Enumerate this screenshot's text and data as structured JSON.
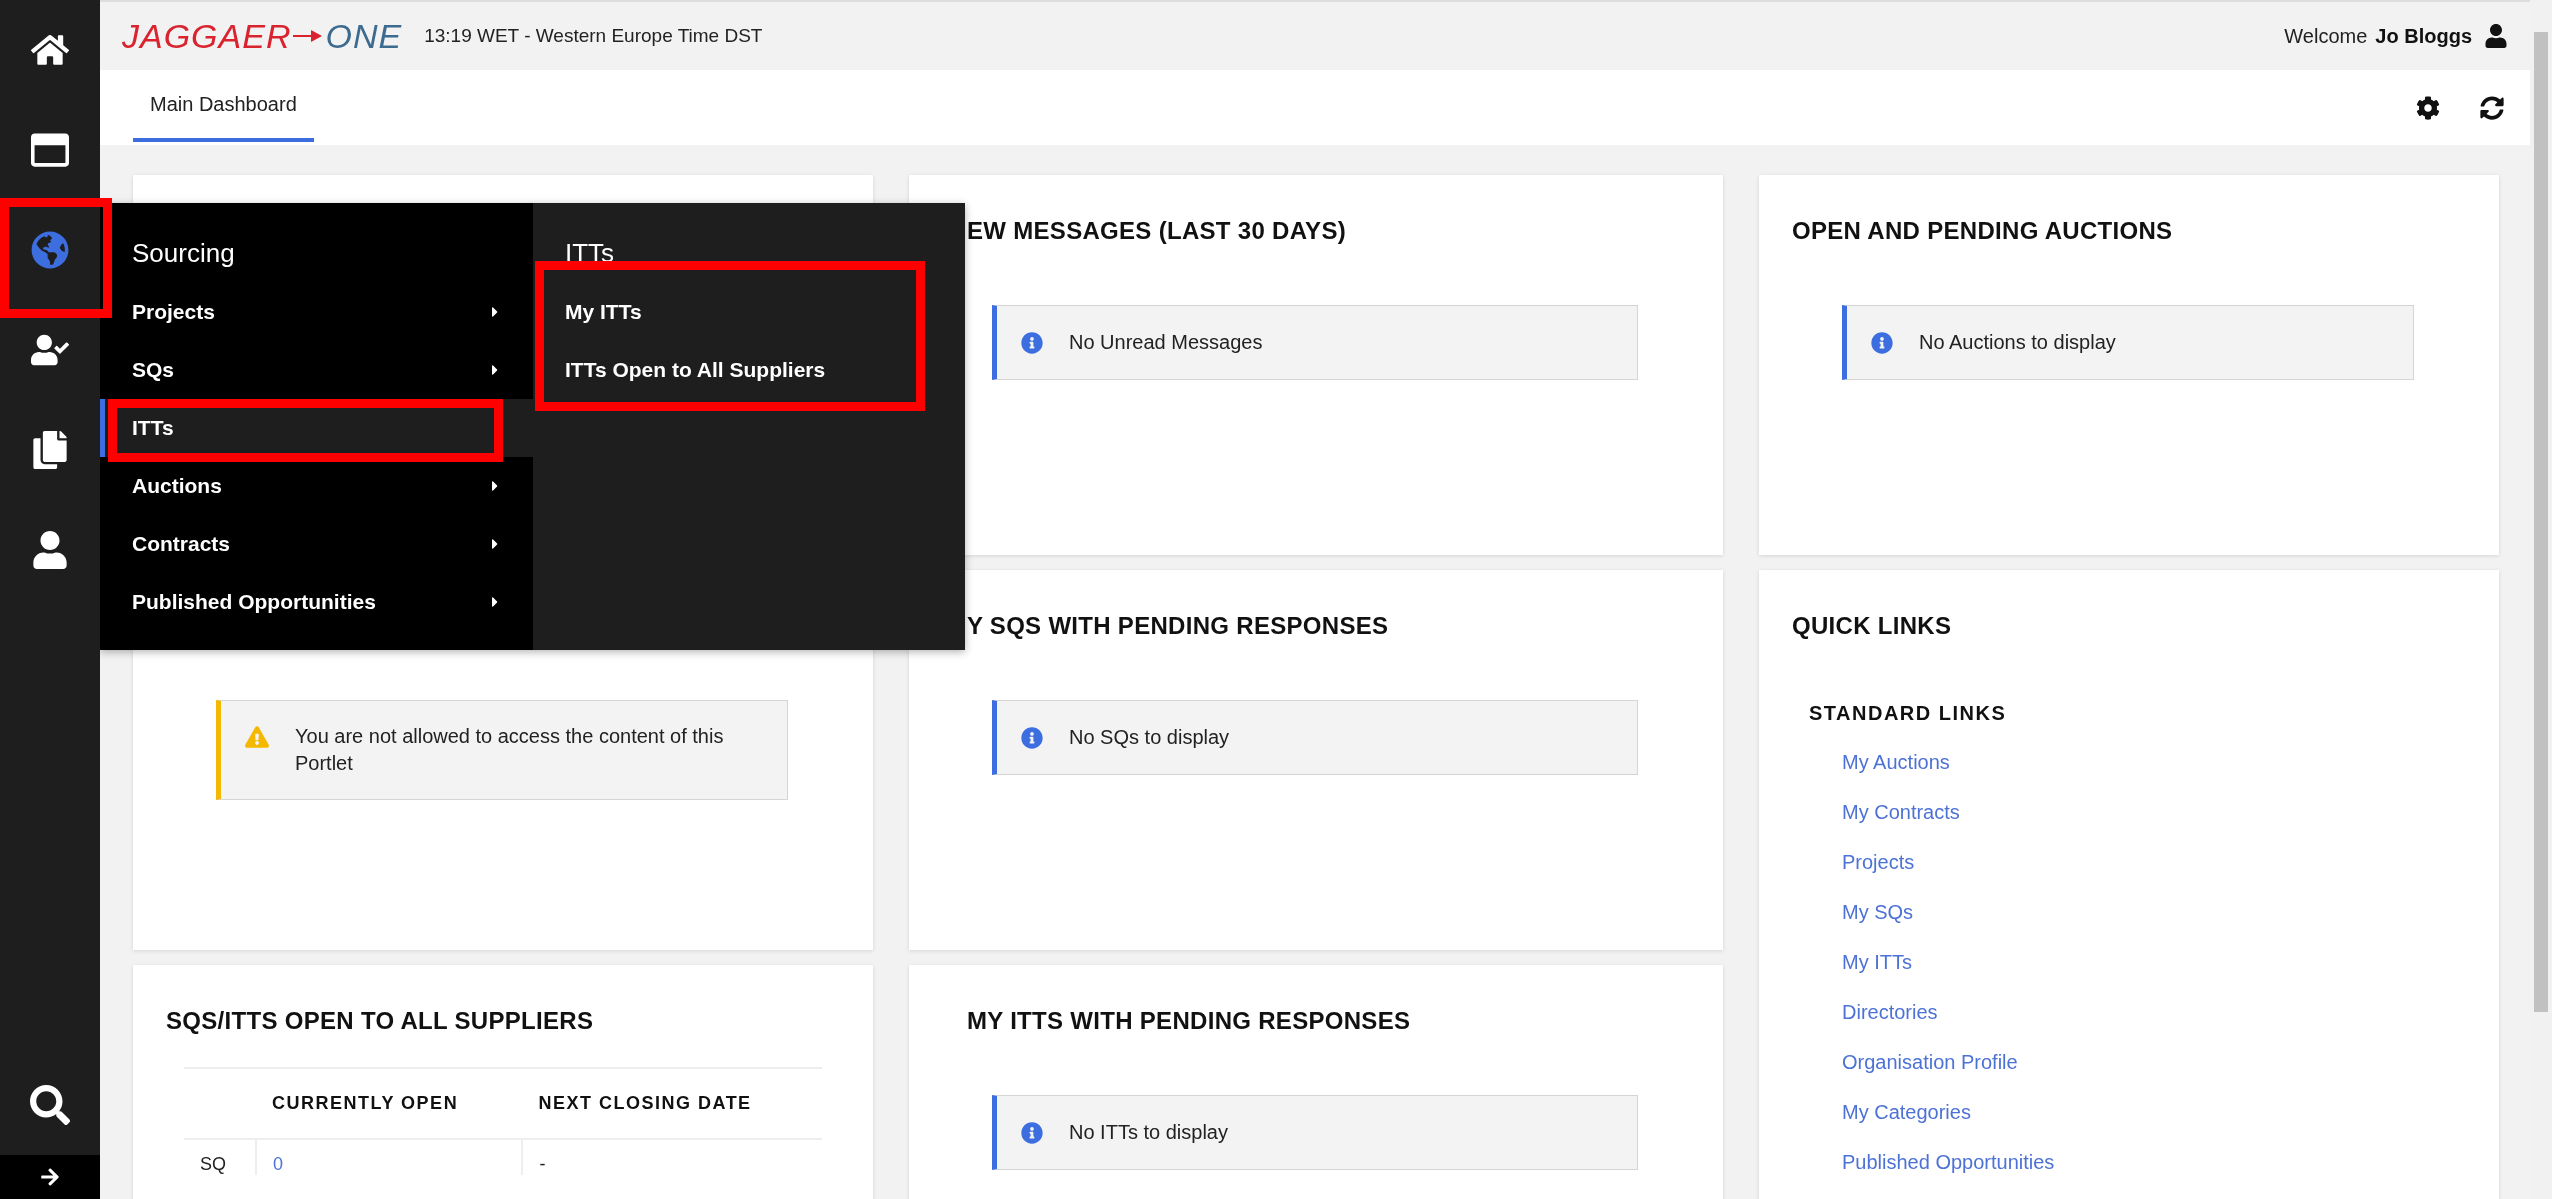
{
  "sidebar": {
    "items": [
      {
        "selected": false,
        "annotated": false
      },
      {
        "selected": false,
        "annotated": false
      },
      {
        "selected": true,
        "annotated": true
      },
      {
        "selected": false,
        "annotated": false
      },
      {
        "selected": false,
        "annotated": false
      },
      {
        "selected": false,
        "annotated": false
      }
    ]
  },
  "header": {
    "logo": {
      "brand": "JAGGAER",
      "product": "ONE"
    },
    "time": "13:19 WET - Western Europe Time DST",
    "welcome": "Welcome",
    "user": "Jo Bloggs"
  },
  "tabs": [
    {
      "label": "Main Dashboard",
      "selected": true
    }
  ],
  "flyout": {
    "title": "Sourcing",
    "items": [
      {
        "label": "Projects",
        "selected": false,
        "annotated": false
      },
      {
        "label": "SQs",
        "selected": false,
        "annotated": false
      },
      {
        "label": "ITTs",
        "selected": true,
        "annotated": true
      },
      {
        "label": "Auctions",
        "selected": false,
        "annotated": false
      },
      {
        "label": "Contracts",
        "selected": false,
        "annotated": false
      },
      {
        "label": "Published Opportunities",
        "selected": false,
        "annotated": false
      }
    ],
    "submenu": {
      "title": "ITTs",
      "annotated": true,
      "items": [
        "My ITTs",
        "ITTs Open to All Suppliers"
      ]
    }
  },
  "columns": [
    [
      {
        "kind": "empty"
      },
      {
        "kind": "warning",
        "message": "You are not allowed to access the content of this Portlet"
      },
      {
        "kind": "table",
        "title": "SQS/ITTS OPEN TO ALL SUPPLIERS",
        "columns": [
          "CURRENTLY OPEN",
          "NEXT CLOSING DATE"
        ],
        "rows": [
          {
            "label": "SQ",
            "cells": [
              "0",
              "-"
            ]
          }
        ]
      }
    ],
    [
      {
        "kind": "info",
        "title": "EW MESSAGES (LAST 30 DAYS)",
        "message": "No Unread Messages"
      },
      {
        "kind": "info",
        "title": "Y SQS WITH PENDING RESPONSES",
        "message": "No SQs to display"
      },
      {
        "kind": "info",
        "title": "MY ITTS WITH PENDING RESPONSES",
        "message": "No ITTs to display"
      }
    ],
    [
      {
        "kind": "info",
        "title": "OPEN AND PENDING AUCTIONS",
        "message": "No Auctions to display"
      },
      {
        "kind": "links",
        "title": "QUICK LINKS",
        "group": "STANDARD LINKS",
        "links": [
          "My Auctions",
          "My Contracts",
          "Projects",
          "My SQs",
          "My ITTs",
          "Directories",
          "Organisation Profile",
          "My Categories",
          "Published Opportunities"
        ]
      }
    ]
  ]
}
